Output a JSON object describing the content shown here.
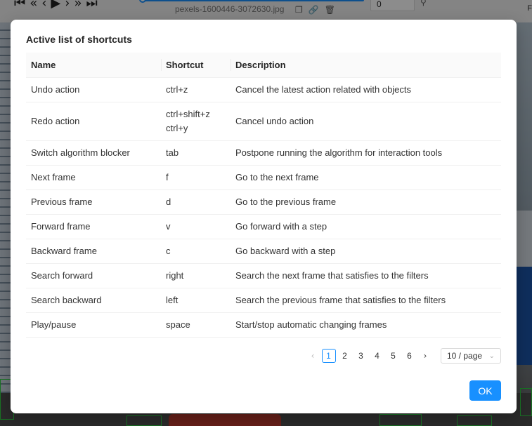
{
  "background": {
    "filename": "pexels-1600446-3072630.jpg",
    "frame_value": "0",
    "right_label": "F",
    "nav_icons": [
      "first-frame-icon",
      "back-step-icon",
      "prev-frame-icon",
      "play-icon",
      "next-frame-icon",
      "forward-step-icon",
      "last-frame-icon"
    ],
    "file_icons": [
      "copy-icon",
      "link-icon",
      "delete-icon"
    ]
  },
  "modal": {
    "title": "Active list of shortcuts",
    "columns": [
      "Name",
      "Shortcut",
      "Description"
    ],
    "rows": [
      {
        "name": "Undo action",
        "keys": [
          "ctrl+z"
        ],
        "description": "Cancel the latest action related with objects"
      },
      {
        "name": "Redo action",
        "keys": [
          "ctrl+shift+z",
          "ctrl+y"
        ],
        "description": "Cancel undo action"
      },
      {
        "name": "Switch algorithm blocker",
        "keys": [
          "tab"
        ],
        "description": "Postpone running the algorithm for interaction tools"
      },
      {
        "name": "Next frame",
        "keys": [
          "f"
        ],
        "description": "Go to the next frame"
      },
      {
        "name": "Previous frame",
        "keys": [
          "d"
        ],
        "description": "Go to the previous frame"
      },
      {
        "name": "Forward frame",
        "keys": [
          "v"
        ],
        "description": "Go forward with a step"
      },
      {
        "name": "Backward frame",
        "keys": [
          "c"
        ],
        "description": "Go backward with a step"
      },
      {
        "name": "Search forward",
        "keys": [
          "right"
        ],
        "description": "Search the next frame that satisfies to the filters"
      },
      {
        "name": "Search backward",
        "keys": [
          "left"
        ],
        "description": "Search the previous frame that satisfies to the filters"
      },
      {
        "name": "Play/pause",
        "keys": [
          "space"
        ],
        "description": "Start/stop automatic changing frames"
      }
    ],
    "pagination": {
      "prev_icon": "chevron-left-icon",
      "next_icon": "chevron-right-icon",
      "pages": [
        "1",
        "2",
        "3",
        "4",
        "5",
        "6"
      ],
      "current": "1",
      "page_size": "10 / page"
    },
    "ok_label": "OK"
  },
  "colors": {
    "primary": "#1890ff",
    "header_bg": "#fafafa",
    "bbox": "#2fd142"
  }
}
